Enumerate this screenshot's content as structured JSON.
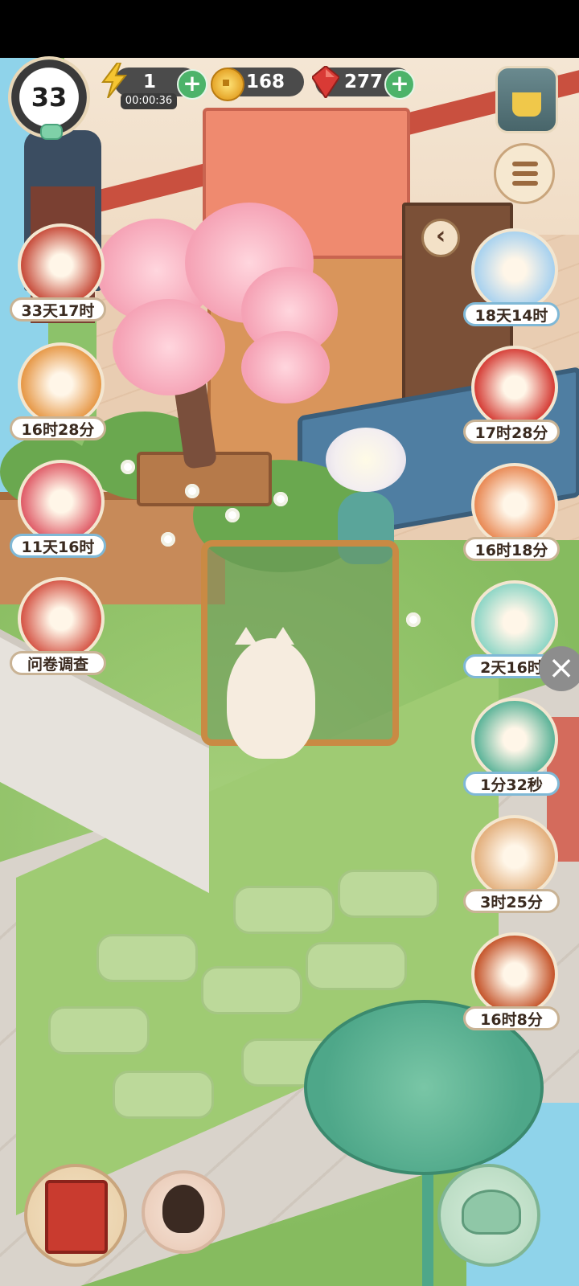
{
  "player": {
    "level": "33"
  },
  "resources": {
    "energy": {
      "value": "1",
      "timer": "00:00:36"
    },
    "coins": {
      "value": "168"
    },
    "gems": {
      "value": "277"
    }
  },
  "left_events": [
    {
      "label": "33天17时",
      "icon": "letters-event-icon",
      "color": "#c84f3e"
    },
    {
      "label": "16时28分",
      "icon": "fox-event-icon",
      "color": "#e79a4a"
    },
    {
      "label": "11天16时",
      "icon": "lantern-event-icon",
      "color": "#e05f6a"
    },
    {
      "label": "问卷调查",
      "icon": "survey-scroll-icon",
      "color": "#d6594a"
    }
  ],
  "right_events": [
    {
      "label": "18天14时",
      "icon": "dragon-cat-event-icon",
      "color": "#a9d2ef"
    },
    {
      "label": "17时28分",
      "icon": "red-envelope-event-icon",
      "color": "#d6413a"
    },
    {
      "label": "16时18分",
      "icon": "fortune-cat-event-icon",
      "color": "#e98b57"
    },
    {
      "label": "2天16时",
      "icon": "mint-cat-event-icon",
      "color": "#8fd6c6"
    },
    {
      "label": "1分32秒",
      "icon": "treasure-cart-event-icon",
      "color": "#5fb59a"
    },
    {
      "label": "3时25分",
      "icon": "roast-feast-event-icon",
      "color": "#e3b07e"
    },
    {
      "label": "16时8分",
      "icon": "plus-one-event-icon",
      "color": "#c6582f"
    }
  ],
  "colors": {
    "plus": "#4cb36a",
    "pill": "#4b4b4b"
  }
}
